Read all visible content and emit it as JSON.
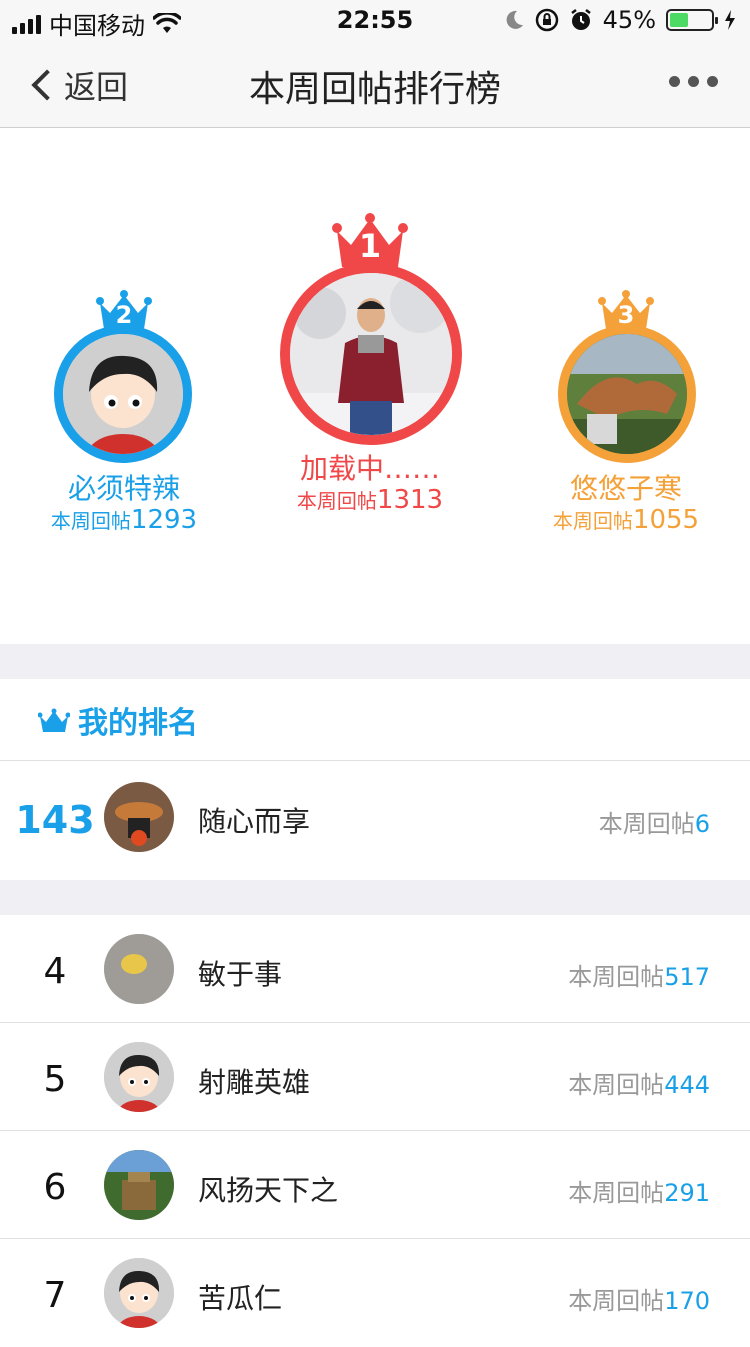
{
  "status": {
    "carrier": "中国移动",
    "time": "22:55",
    "battery": "45%",
    "battery_level": 0.45
  },
  "nav": {
    "back_label": "返回",
    "title": "本周回帖排行榜"
  },
  "top3": [
    {
      "rank": "1",
      "name": "加载中……",
      "count_label": "本周回帖",
      "count": "1313",
      "color": "#f04848"
    },
    {
      "rank": "2",
      "name": "必须特辣",
      "count_label": "本周回帖",
      "count": "1293",
      "color": "#1aa0e8"
    },
    {
      "rank": "3",
      "name": "悠悠子寒",
      "count_label": "本周回帖",
      "count": "1055",
      "color": "#f5a13a"
    }
  ],
  "my_rank": {
    "header": "我的排名",
    "rank": "143",
    "name": "随心而享",
    "count_label": "本周回帖",
    "count": "6"
  },
  "list": [
    {
      "rank": "4",
      "name": "敏于事",
      "count_label": "本周回帖",
      "count": "517"
    },
    {
      "rank": "5",
      "name": "射雕英雄",
      "count_label": "本周回帖",
      "count": "444"
    },
    {
      "rank": "6",
      "name": "风扬天下之",
      "count_label": "本周回帖",
      "count": "291"
    },
    {
      "rank": "7",
      "name": "苦瓜仁",
      "count_label": "本周回帖",
      "count": "170"
    }
  ],
  "colors": {
    "accent": "#1aa0e8",
    "gold": "#f04848",
    "silver": "#1aa0e8",
    "bronze": "#f5a13a"
  }
}
